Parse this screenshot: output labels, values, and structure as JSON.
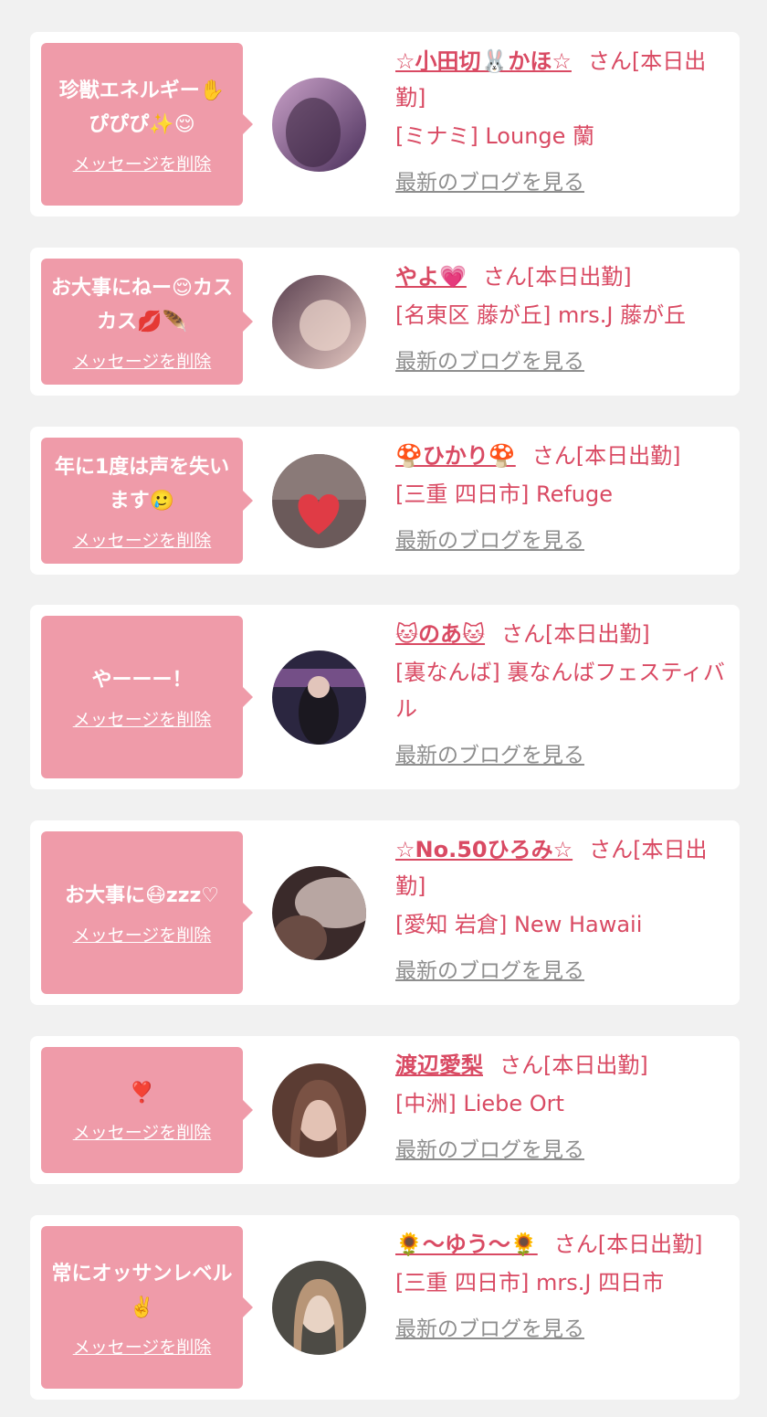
{
  "favorites": [
    {
      "message": "珍獣エネルギー✋ ぴぴぴ✨😌",
      "delete_label": "メッセージを削除",
      "name": "☆小田切🐰かほ☆",
      "suffix": "さん[本日出勤]",
      "shop": "[ミナミ] Lounge 蘭",
      "blog_label": "最新のブログを見る",
      "avatar_colors": [
        "#4a2f5a",
        "#c9a1c8"
      ]
    },
    {
      "message": "お大事にねー😌カスカス💋🪶",
      "delete_label": "メッセージを削除",
      "name": "やよ💗",
      "suffix": "さん[本日出勤]",
      "shop": "[名東区 藤が丘] mrs.J 藤が丘",
      "blog_label": "最新のブログを見る",
      "avatar_colors": [
        "#5a4050",
        "#e6c9c2"
      ]
    },
    {
      "message": "年に1度は声を失います🥲",
      "delete_label": "メッセージを削除",
      "name": "🍄ひかり🍄",
      "suffix": "さん[本日出勤]",
      "shop": "[三重 四日市] Refuge",
      "blog_label": "最新のブログを見る",
      "avatar_colors": [
        "#6b5a5a",
        "#e03b45"
      ]
    },
    {
      "message": "やーーー！",
      "delete_label": "メッセージを削除",
      "name": "🐱のあ🐱",
      "suffix": "さん[本日出勤]",
      "shop": "[裏なんば] 裏なんばフェスティバル",
      "blog_label": "最新のブログを見る",
      "avatar_colors": [
        "#2b2640",
        "#a56bb8"
      ]
    },
    {
      "message": "お大事に😷zzz♡",
      "delete_label": "メッセージを削除",
      "name": "☆No.50ひろみ☆",
      "suffix": "さん[本日出勤]",
      "shop": "[愛知 岩倉] New Hawaii",
      "blog_label": "最新のブログを見る",
      "avatar_colors": [
        "#3a2a2a",
        "#d8c6c0"
      ]
    },
    {
      "message": "❣️",
      "delete_label": "メッセージを削除",
      "name": "渡辺愛梨",
      "suffix": "さん[本日出勤]",
      "shop": "[中洲] Liebe Ort",
      "blog_label": "最新のブログを見る",
      "avatar_colors": [
        "#5b3c33",
        "#e3c2b4"
      ]
    },
    {
      "message": "常にオッサンレベル✌️",
      "delete_label": "メッセージを削除",
      "name": "🌻〜ゆう〜🌻",
      "suffix": "さん[本日出勤]",
      "shop": "[三重 四日市] mrs.J 四日市",
      "blog_label": "最新のブログを見る",
      "avatar_colors": [
        "#4d4b45",
        "#e8d3c4"
      ]
    }
  ]
}
